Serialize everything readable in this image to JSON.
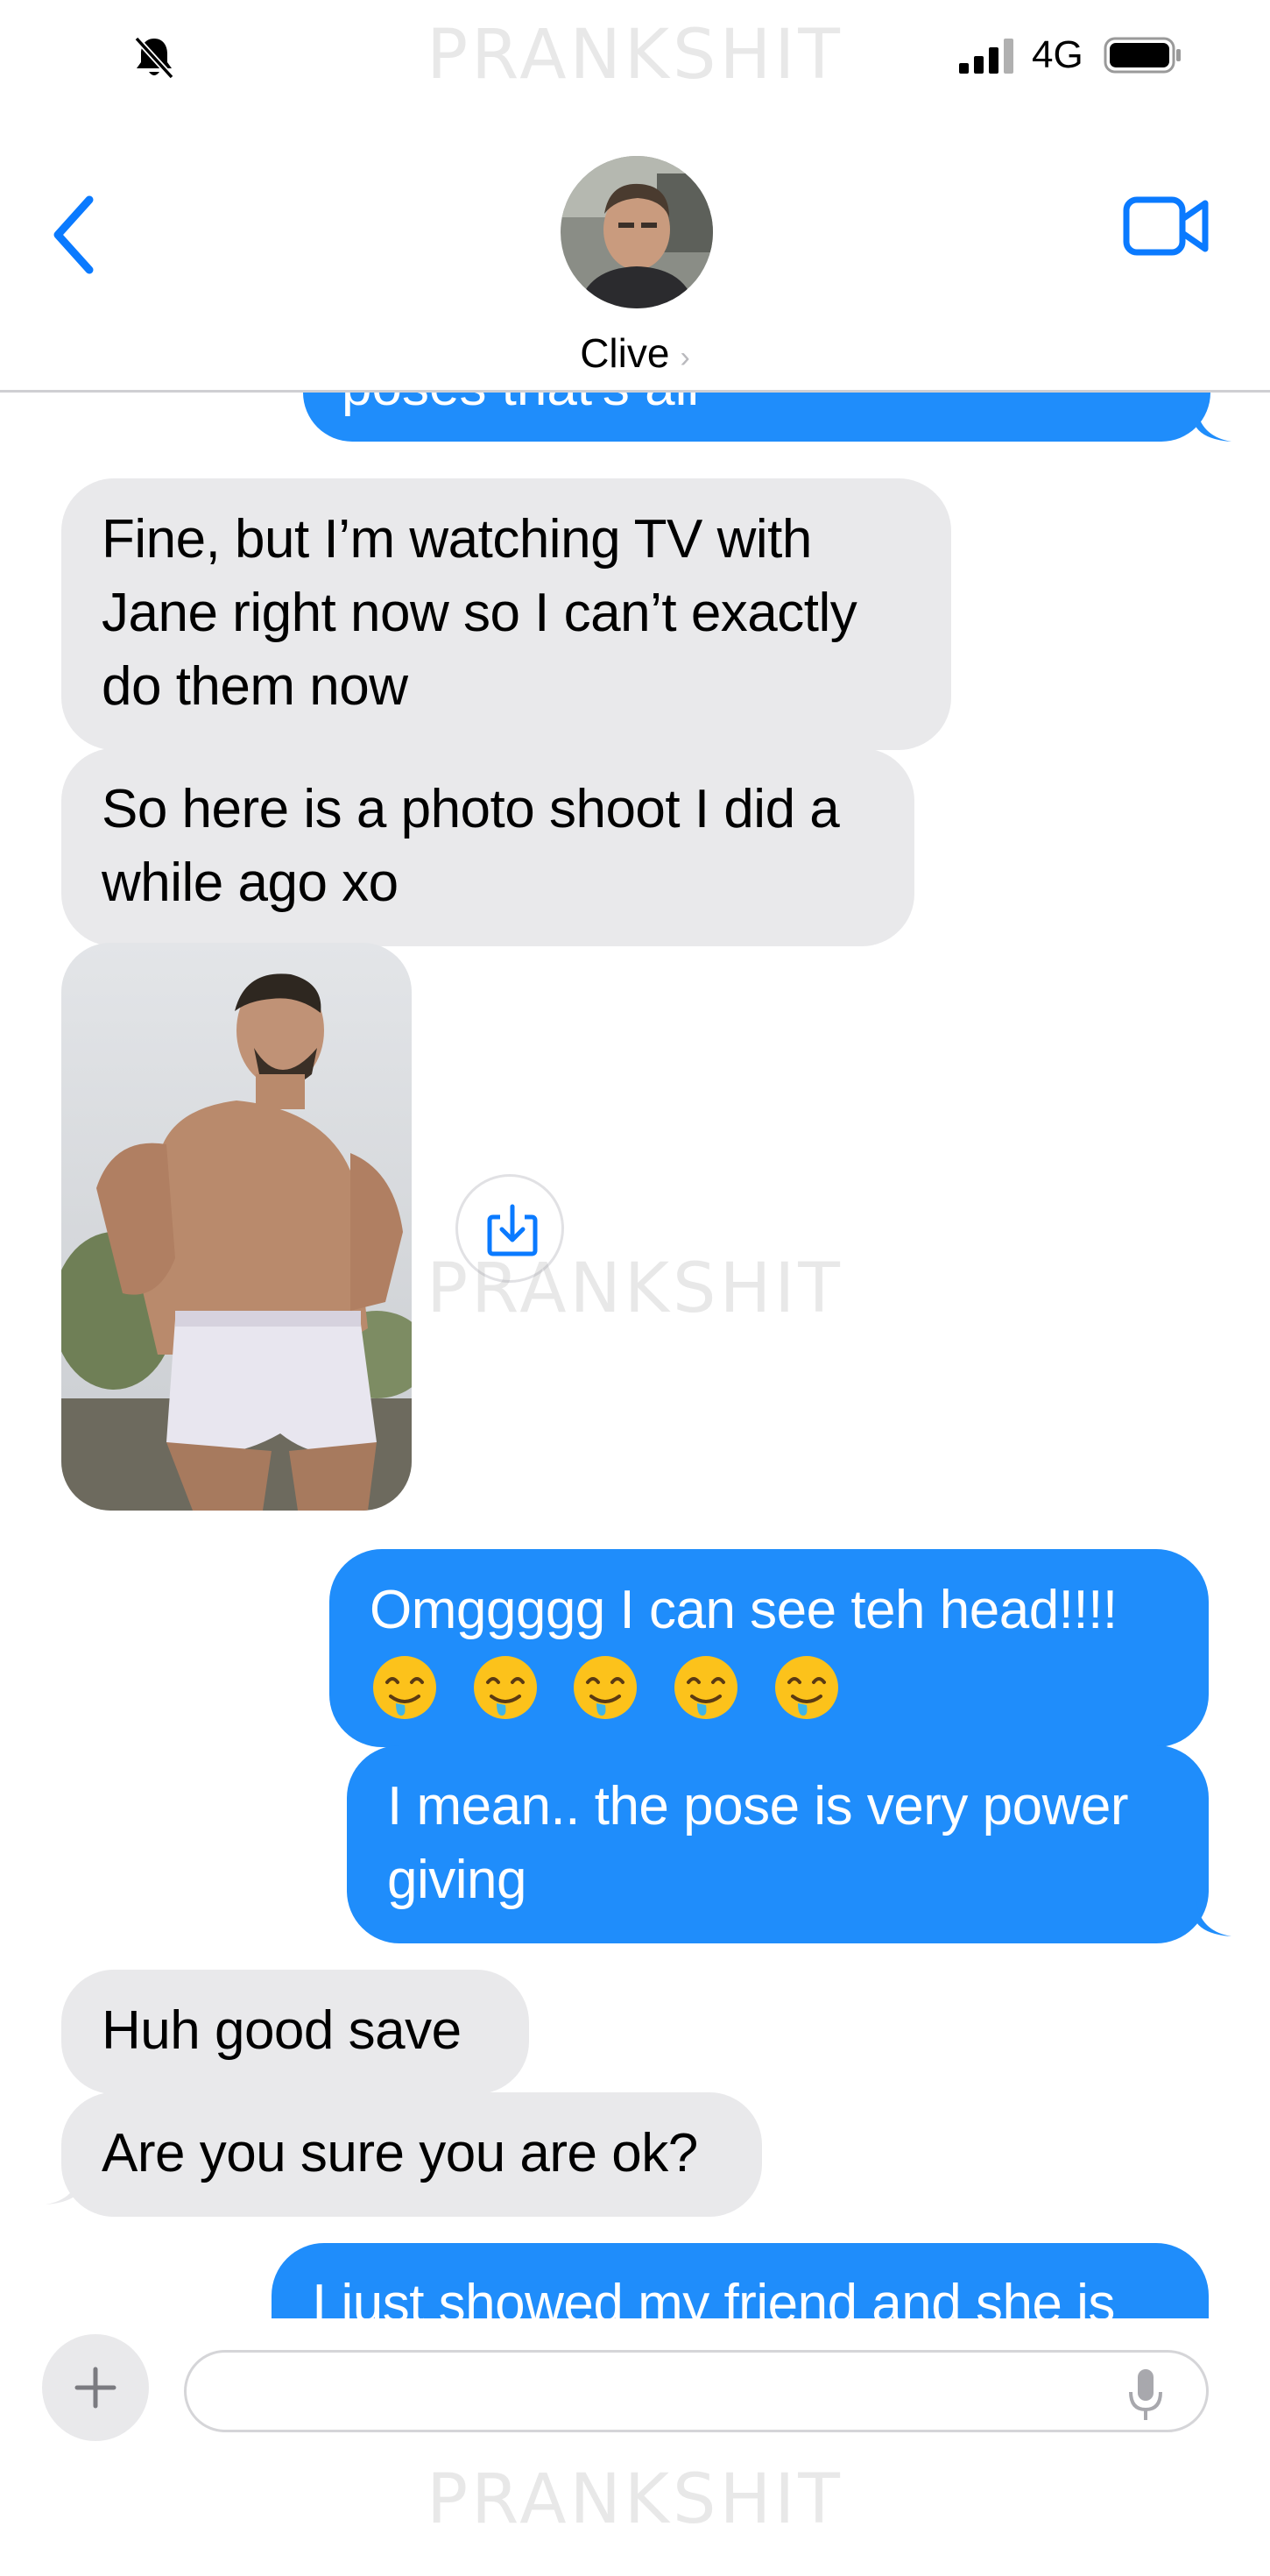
{
  "status_bar": {
    "network": "4G",
    "icons": [
      "bell-slash-icon",
      "signal-bars-icon",
      "battery-icon"
    ]
  },
  "watermark": "PRANKSHIT",
  "header": {
    "contact_name": "Clive",
    "chevron": "›",
    "icons": [
      "chevron-left-icon",
      "avatar",
      "video-camera-icon"
    ]
  },
  "conversation": {
    "partial_top_message": "poses that's all",
    "messages": [
      {
        "direction": "incoming",
        "text": "Fine, but I’m watching TV with Jane right now so I can’t exactly do them now"
      },
      {
        "direction": "incoming",
        "text": "So here is a photo shoot I did a while ago xo"
      },
      {
        "direction": "incoming",
        "type": "photo",
        "download_icon": "download-icon"
      },
      {
        "direction": "outgoing",
        "text": "Omggggg I can see teh head!!!!",
        "emoji_count": 5,
        "emoji": "drooling-face-emoji"
      },
      {
        "direction": "outgoing",
        "text": "I mean.. the pose is very power giving"
      },
      {
        "direction": "incoming",
        "text": "Huh good save"
      },
      {
        "direction": "incoming",
        "text": "Are you sure you are ok?"
      },
      {
        "direction": "outgoing",
        "text": "I just showed my friend and she is"
      }
    ]
  },
  "input": {
    "value": "",
    "placeholder": "",
    "icons": [
      "plus-icon",
      "microphone-icon"
    ]
  },
  "colors": {
    "outgoing_bubble": "#1f8dfb",
    "incoming_bubble": "#e9e9eb",
    "accent": "#0a7aff"
  }
}
